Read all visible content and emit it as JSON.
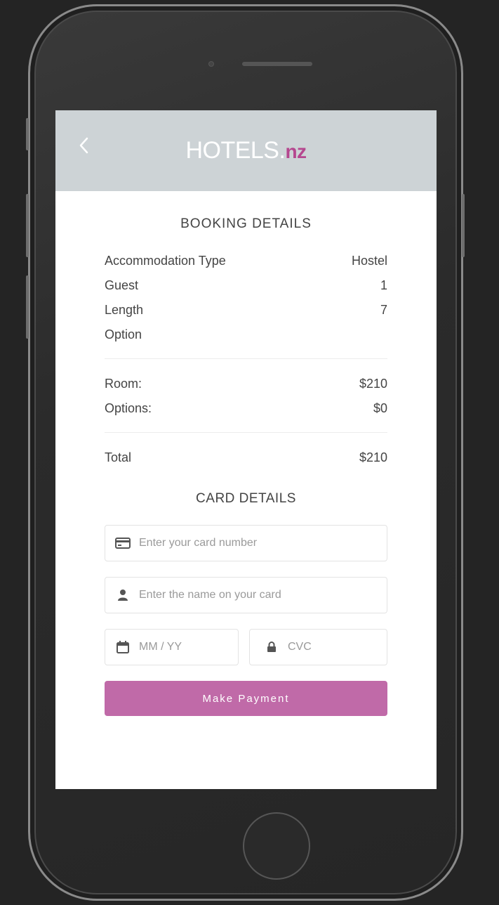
{
  "header": {
    "back_icon": "chevron-left-icon",
    "logo_main": "HOTELS.",
    "logo_tld": "nz",
    "logo_accent_color": "#b5478f"
  },
  "booking": {
    "title": "BOOKING DETAILS",
    "rows": [
      {
        "label": "Accommodation Type",
        "value": "Hostel"
      },
      {
        "label": "Guest",
        "value": "1"
      },
      {
        "label": "Length",
        "value": "7"
      },
      {
        "label": "Option",
        "value": ""
      }
    ],
    "costs": [
      {
        "label": "Room:",
        "value": "$210"
      },
      {
        "label": "Options:",
        "value": "$0"
      }
    ],
    "total": {
      "label": "Total",
      "value": "$210"
    }
  },
  "card": {
    "title": "CARD DETAILS",
    "number_placeholder": "Enter your card number",
    "name_placeholder": "Enter the name on your card",
    "expiry_placeholder": "MM / YY",
    "cvc_placeholder": "CVC",
    "icons": {
      "number": "credit-card-icon",
      "name": "user-icon",
      "expiry": "calendar-icon",
      "cvc": "lock-icon"
    }
  },
  "payment": {
    "button_label": "Make Payment",
    "button_color": "#c06aa8"
  },
  "colors": {
    "header_bg": "#cdd3d6",
    "device_bg": "#242424"
  }
}
